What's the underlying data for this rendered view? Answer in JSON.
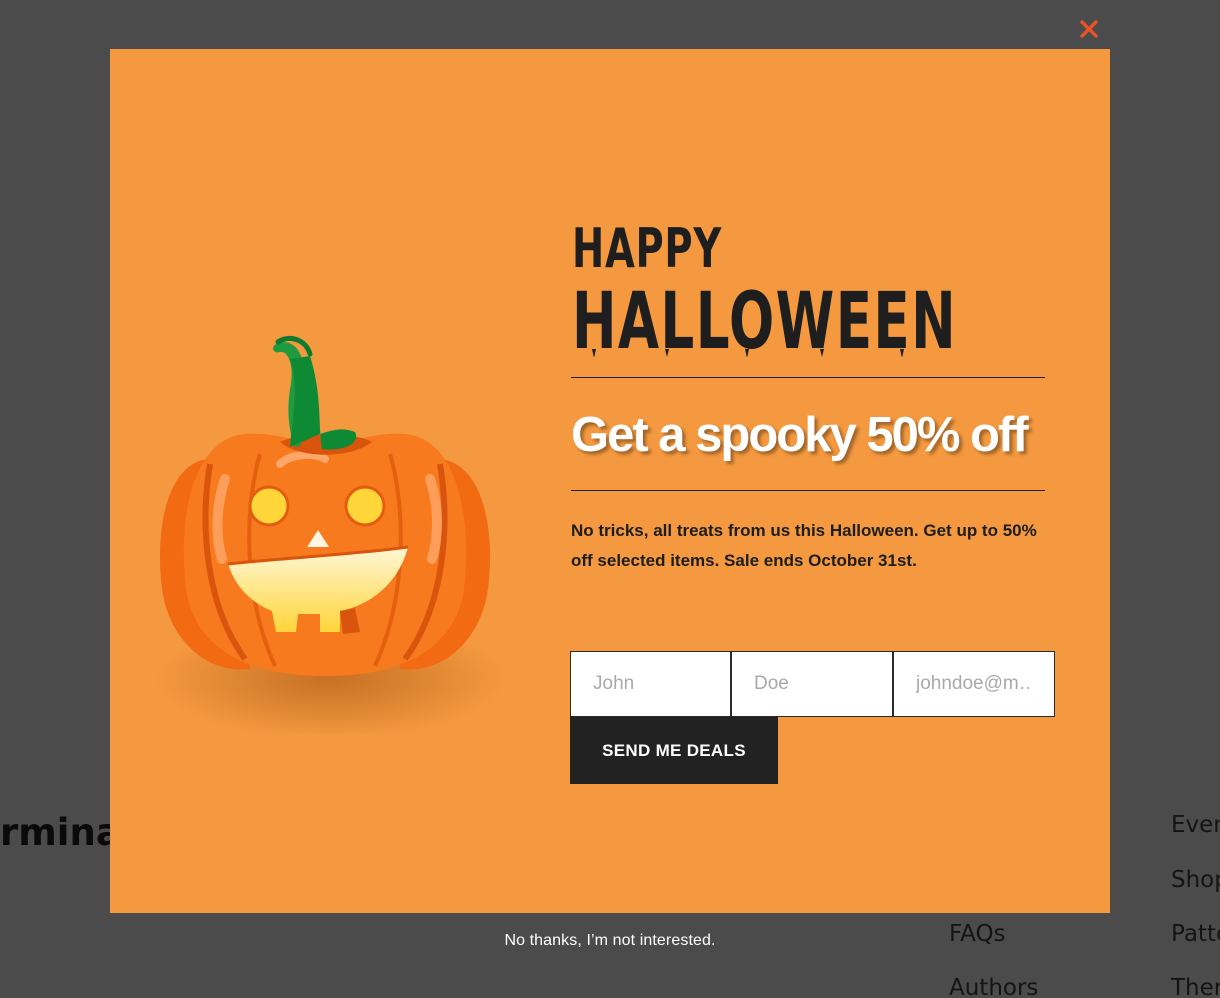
{
  "background": {
    "heading_fragment": "rminat",
    "links_col1": [
      "FAQs",
      "Authors"
    ],
    "links_col2": [
      "Event",
      "Shop",
      "Patte",
      "Them"
    ]
  },
  "modal": {
    "close_icon": "close-icon",
    "title_line1": "HAPPY",
    "title_line2": "HALLOWEEN",
    "headline": "Get a spooky 50% off",
    "body": "No tricks, all treats from us this Halloween. Get up to 50% off selected items. Sale ends October 31st.",
    "form": {
      "first_name_placeholder": "John",
      "last_name_placeholder": "Doe",
      "email_placeholder": "johndoe@m…",
      "submit_label": "SEND ME DEALS"
    },
    "dismiss_label": "No thanks, I’m not interested."
  },
  "colors": {
    "modal_bg": "#f4993f",
    "overlay": "#4b4b4b",
    "close": "#e8532a",
    "button": "#222222"
  }
}
